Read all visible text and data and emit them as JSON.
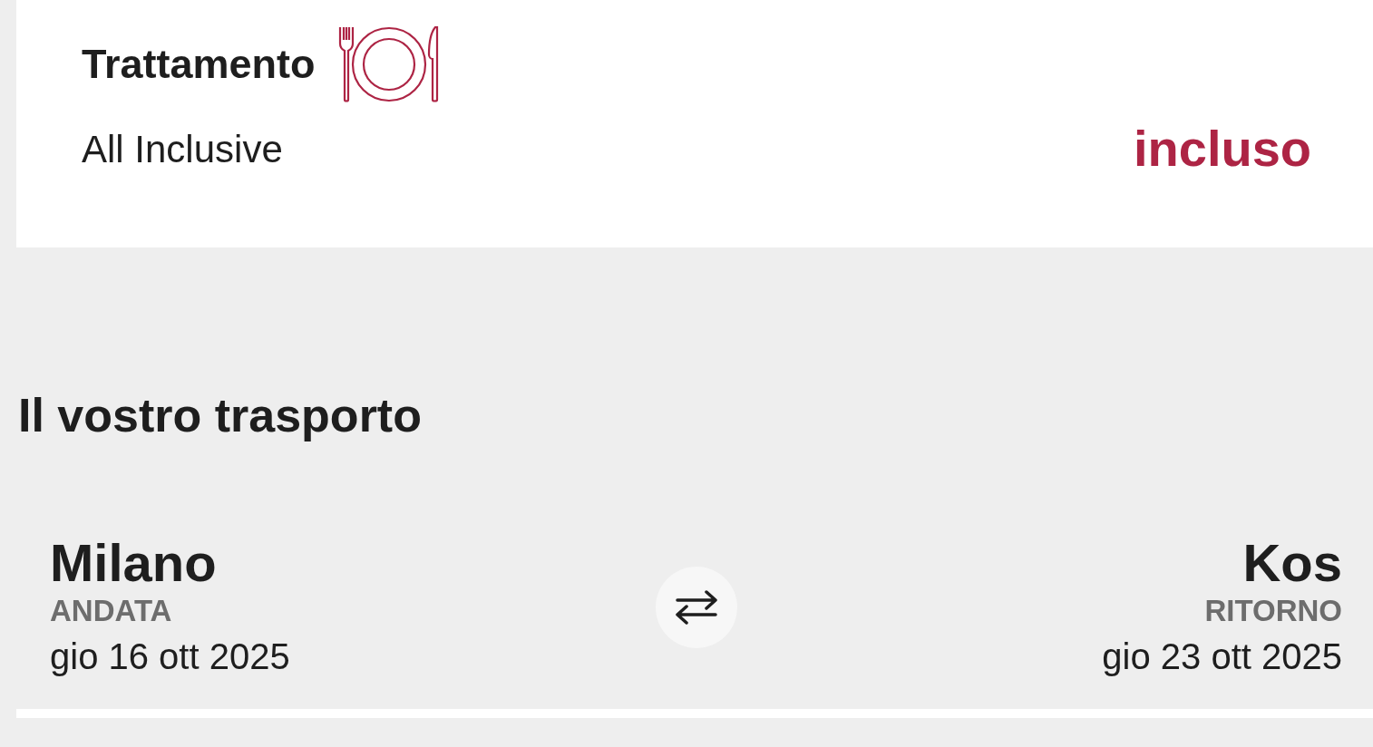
{
  "treatment": {
    "title": "Trattamento",
    "name": "All Inclusive",
    "price": "incluso"
  },
  "transport": {
    "heading": "Il vostro trasporto",
    "legs": [
      {
        "city": "Milano",
        "label": "ANDATA",
        "date": "gio 16 ott 2025"
      },
      {
        "city": "Kos",
        "label": "RITORNO",
        "date": "gio 23 ott 2025"
      }
    ]
  }
}
